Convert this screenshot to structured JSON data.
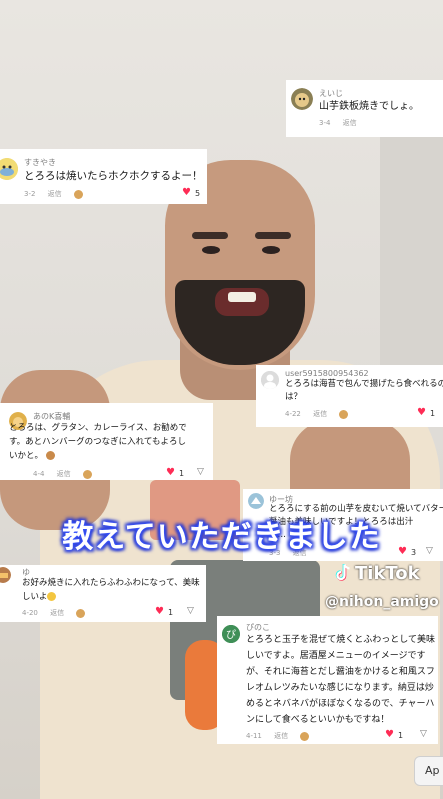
{
  "overlay": {
    "caption": "教えていただきました",
    "tiktok_logo": "TikTok",
    "handle": "@nihon_amigo",
    "app_button": "Ap"
  },
  "comments": [
    {
      "username": "すきやき",
      "text": "とろろは焼いたらホクホクするよー！",
      "date": "3-2",
      "reply": "返信",
      "likes": "5"
    },
    {
      "username": "えいじ",
      "text": "山芋鉄板焼きでしょ。",
      "date": "3-4",
      "reply": "返信"
    },
    {
      "username": "user5915800954362",
      "text_line1": "とろろは海苔で包んで揚げたら食べれるの",
      "text_line2": "は？",
      "date": "4-22",
      "reply": "返信",
      "likes": "1"
    },
    {
      "username": "あのK喜輔",
      "text_line1": "とろろは、グラタン、カレーライス、お勧めで",
      "text_line2": "す。あとハンバーグのつなぎに入れてもよろし",
      "text_line3": "いかと。",
      "date": "4-4",
      "reply": "返信",
      "likes": "1"
    },
    {
      "username": "ゆー坊",
      "text_line1": "とろろにする前の山芋を皮むいて焼いてバター",
      "text_line2": "醤油も美味しいですよ！とろろは出汁",
      "text_line3": "で…",
      "date": "3-3",
      "reply": "返信",
      "likes": "3"
    },
    {
      "username": "ゆ",
      "text_line1": "お好み焼きに入れたらふわふわになって、美味",
      "text_line2": "しいよ",
      "date": "4-20",
      "reply": "返信",
      "likes": "1"
    },
    {
      "username": "ぴのこ",
      "text_line1": "とろろと玉子を混ぜて焼くとふわっとして美味",
      "text_line2": "しいですよ。居酒屋メニューのイメージです",
      "text_line3": "が、それに海苔とだし醤油をかけると和風スフ",
      "text_line4": "レオムレツみたいな感じになります。納豆は炒",
      "text_line5": "めるとネバネバがほぼなくなるので、チャーハ",
      "text_line6": "ンにして食べるといいかもですね！",
      "date": "4-11",
      "reply": "返信",
      "likes": "1"
    }
  ],
  "colors": {
    "heart": "#fe2c55",
    "caption_glow": "#3d59ff"
  }
}
